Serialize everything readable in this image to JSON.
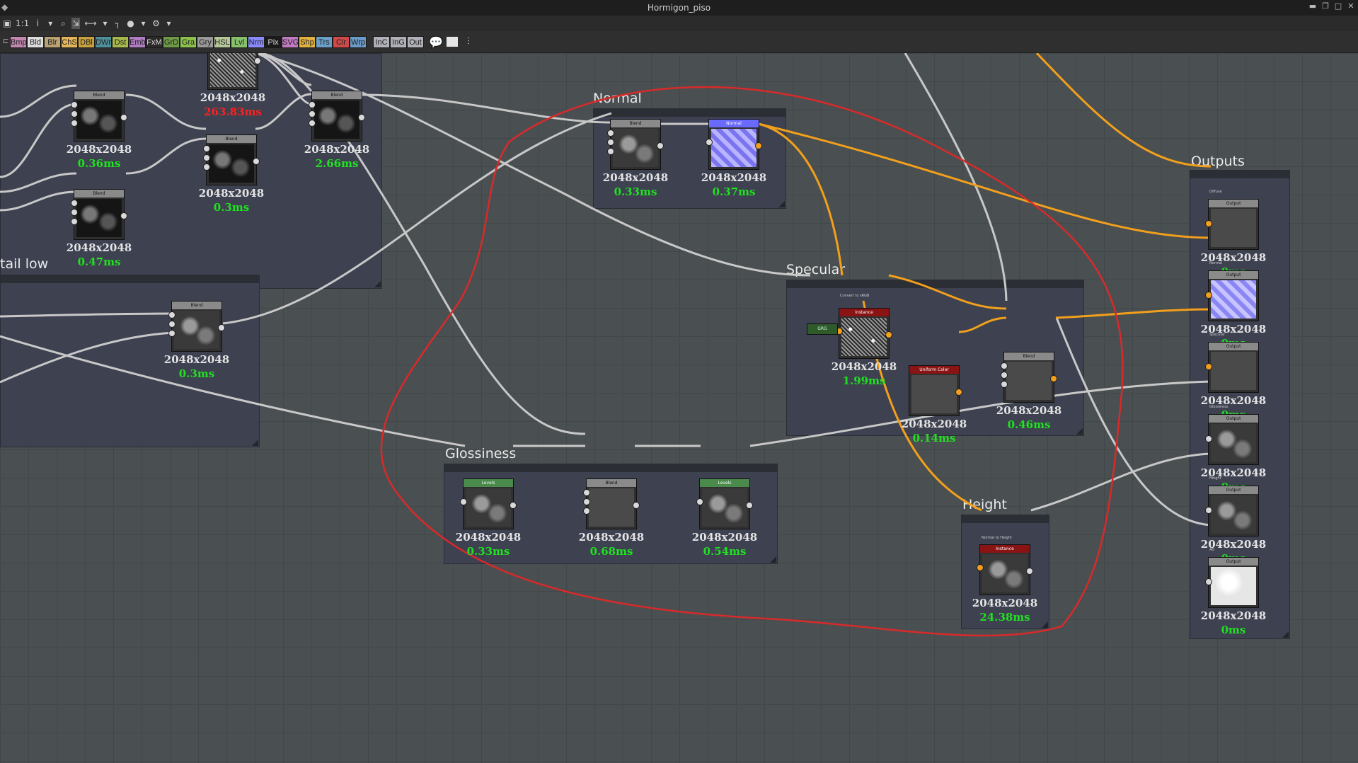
{
  "window": {
    "title": "Hormigon_piso",
    "controls": [
      "pin-icon",
      "restore-icon",
      "maximize-icon",
      "close-icon"
    ]
  },
  "toolbar1": {
    "zoom_label": "1:1",
    "info_label": "i"
  },
  "toolbar2": {
    "nodes": [
      {
        "label": "Bmp",
        "color": "#c487b0"
      },
      {
        "label": "Bld",
        "color": "#dcdcdc"
      },
      {
        "label": "Blr",
        "color": "#b8a274"
      },
      {
        "label": "ChS",
        "color": "#e4b458"
      },
      {
        "label": "DBl",
        "color": "#c7a13f"
      },
      {
        "label": "DWr",
        "color": "#4f8f9a"
      },
      {
        "label": "Dst",
        "color": "#a6b84a"
      },
      {
        "label": "Emb",
        "color": "#b07cc4"
      },
      {
        "label": "FxM",
        "color": "#2a2a2a"
      },
      {
        "label": "GrD",
        "color": "#6f9a4a"
      },
      {
        "label": "Gra",
        "color": "#8cc04a"
      },
      {
        "label": "Gry",
        "color": "#9a9a9a"
      },
      {
        "label": "HSL",
        "color": "#b6c79a"
      },
      {
        "label": "Lvl",
        "color": "#86c06a"
      },
      {
        "label": "Nrm",
        "color": "#8a8aff"
      },
      {
        "label": "Pix",
        "color": "#1a1a1a"
      },
      {
        "label": "SVG",
        "color": "#c07ac0"
      },
      {
        "label": "Shp",
        "color": "#e2b23e"
      },
      {
        "label": "Trs",
        "color": "#6aa0c8"
      },
      {
        "label": "Clr",
        "color": "#d04848"
      },
      {
        "label": "Wrp",
        "color": "#6a9ac8"
      },
      {
        "label": "InC",
        "color": "#b0b0b8"
      },
      {
        "label": "InG",
        "color": "#b0b0b8"
      },
      {
        "label": "Out",
        "color": "#b0b0b8"
      }
    ]
  },
  "frames": {
    "normal": "Normal",
    "specular": "Specular",
    "glossiness": "Glossiness",
    "height": "Height",
    "outputs": "Outputs",
    "detail_low": "tail low"
  },
  "nodes": {
    "noise_top": {
      "res": "2048x2048",
      "time": "263.83ms"
    },
    "blend_a": {
      "header": "Blend",
      "res": "2048x2048",
      "time": "0.36ms"
    },
    "blend_b": {
      "header": "Blend",
      "res": "2048x2048",
      "time": "0.47ms"
    },
    "blend_c": {
      "header": "Blend",
      "res": "2048x2048",
      "time": "0.3ms"
    },
    "blend_d": {
      "header": "Blend",
      "res": "2048x2048",
      "time": "2.66ms"
    },
    "blend_low": {
      "header": "Blend",
      "res": "2048x2048",
      "time": "0.3ms"
    },
    "normal_blend": {
      "header": "Blend",
      "res": "2048x2048",
      "time": "0.33ms"
    },
    "normal_node": {
      "header": "Normal",
      "res": "2048x2048",
      "time": "0.37ms"
    },
    "spec_instance": {
      "label": "Convert to sRGB",
      "header": "Instance",
      "res": "2048x2048",
      "time": "1.99ms"
    },
    "spec_grey": {
      "header": "GRG"
    },
    "uniform_color": {
      "header": "Uniform Color",
      "res": "2048x2048",
      "time": "0.14ms"
    },
    "spec_blend": {
      "header": "Blend",
      "res": "2048x2048",
      "time": "0.46ms"
    },
    "gloss_levels1": {
      "header": "Levels",
      "res": "2048x2048",
      "time": "0.33ms"
    },
    "gloss_blend": {
      "header": "Blend",
      "res": "2048x2048",
      "time": "0.68ms"
    },
    "gloss_levels2": {
      "header": "Levels",
      "res": "2048x2048",
      "time": "0.54ms"
    },
    "height_instance": {
      "label": "Normal to Height",
      "header": "Instance",
      "res": "2048x2048",
      "time": "24.38ms"
    }
  },
  "outputs": [
    {
      "label": "Diffuse",
      "header": "Output",
      "res": "2048x2048",
      "time": "0ms"
    },
    {
      "label": "Normal",
      "header": "Output",
      "res": "2048x2048",
      "time": "0ms"
    },
    {
      "label": "Specular",
      "header": "Output",
      "res": "2048x2048",
      "time": "0ms"
    },
    {
      "label": "Glossiness",
      "header": "Output",
      "res": "2048x2048",
      "time": "0ms"
    },
    {
      "label": "Height",
      "header": "Output",
      "res": "2048x2048",
      "time": "0ms"
    },
    {
      "label": "AO",
      "header": "Output",
      "res": "2048x2048",
      "time": "0ms"
    }
  ]
}
